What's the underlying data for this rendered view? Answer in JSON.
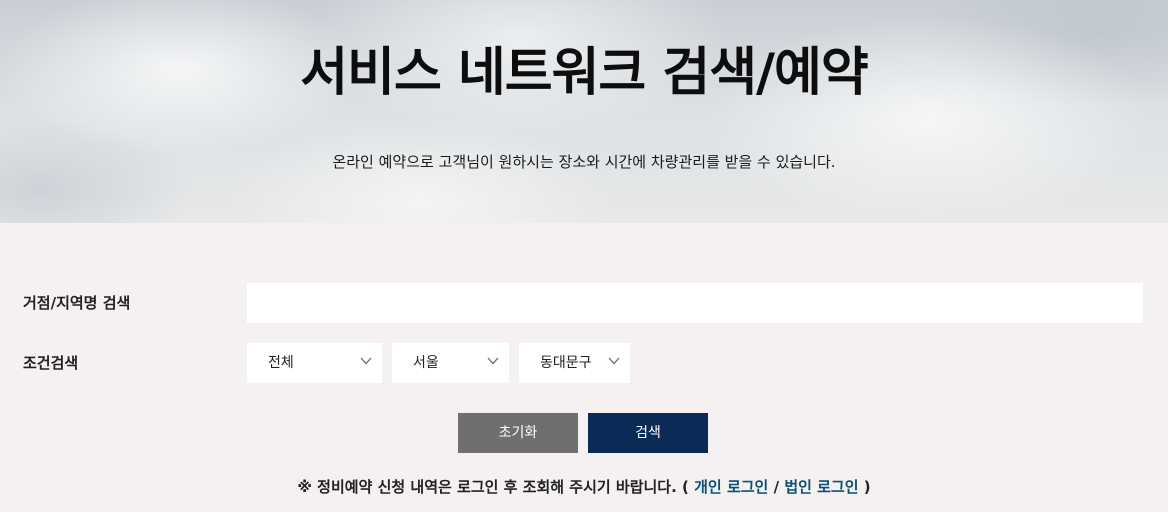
{
  "hero": {
    "title": "서비스 네트워크 검색/예약",
    "subtitle": "온라인 예약으로 고객님이 원하시는 장소와 시간에 차량관리를 받을 수 있습니다."
  },
  "search": {
    "label": "거점/지역명 검색",
    "value": "",
    "placeholder": ""
  },
  "conditions": {
    "label": "조건검색",
    "select1": "전체",
    "select2": "서울",
    "select3": "동대문구"
  },
  "buttons": {
    "reset": "초기화",
    "search": "검색"
  },
  "colors": {
    "reset_bg": "#6f6f6f",
    "search_bg": "#0b2a55",
    "link": "#0b4f75"
  },
  "notice": {
    "prefix": "※ 정비예약 신청 내역은 로그인 후 조회해 주시기 바랍니다. (",
    "personal_login": "개인 로그인",
    "separator": "/",
    "corporate_login": "법인 로그인",
    "suffix": ")"
  }
}
